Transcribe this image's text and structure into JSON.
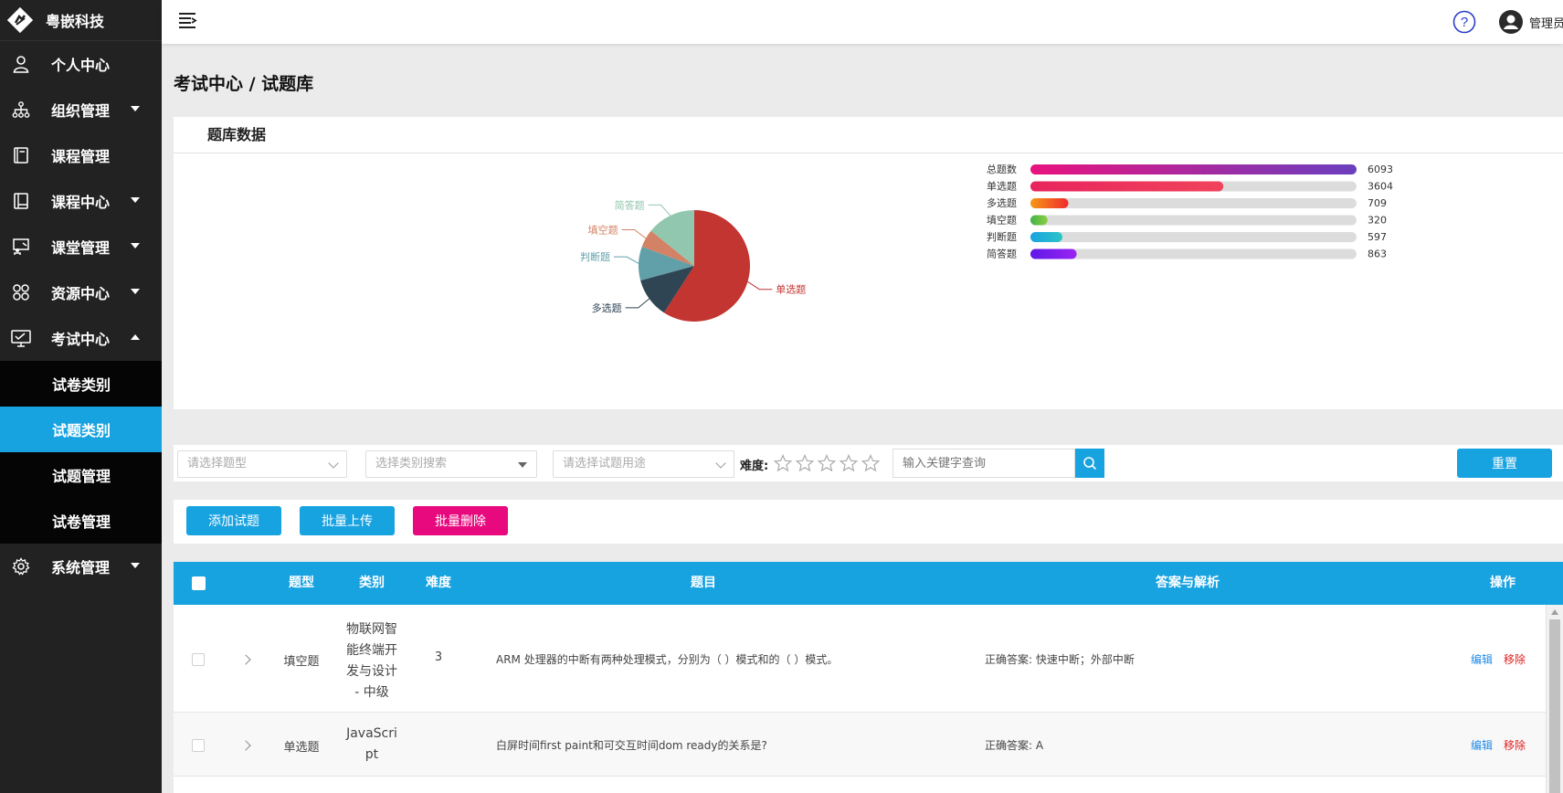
{
  "app": {
    "name": "粤嵌科技"
  },
  "sidebar": {
    "items": [
      {
        "label": "个人中心",
        "icon": "user-icon",
        "has_caret": false
      },
      {
        "label": "组织管理",
        "icon": "org-tree-icon",
        "has_caret": true
      },
      {
        "label": "课程管理",
        "icon": "book-icon",
        "has_caret": false
      },
      {
        "label": "课程中心",
        "icon": "book-open-icon",
        "has_caret": true
      },
      {
        "label": "课堂管理",
        "icon": "classroom-icon",
        "has_caret": true
      },
      {
        "label": "资源中心",
        "icon": "resource-grid-icon",
        "has_caret": true
      },
      {
        "label": "考试中心",
        "icon": "exam-monitor-icon",
        "has_caret": true,
        "expanded": true
      }
    ],
    "sub_items": [
      {
        "label": "试卷类别",
        "active": false
      },
      {
        "label": "试题类别",
        "active": true
      },
      {
        "label": "试题管理",
        "active": false
      },
      {
        "label": "试卷管理",
        "active": false
      }
    ],
    "system": {
      "label": "系统管理",
      "icon": "gear-icon"
    }
  },
  "header": {
    "username": "管理员"
  },
  "page": {
    "title": "考试中心 / 试题库"
  },
  "panel": {
    "title": "题库数据"
  },
  "chart_data": [
    {
      "type": "pie",
      "slices": [
        {
          "label": "单选题",
          "value": 3604,
          "color": "#c23531"
        },
        {
          "label": "多选题",
          "value": 709,
          "color": "#2f4554"
        },
        {
          "label": "判断题",
          "value": 597,
          "color": "#61a0a8"
        },
        {
          "label": "填空题",
          "value": 320,
          "color": "#d48265"
        },
        {
          "label": "简答题",
          "value": 863,
          "color": "#91c7ae"
        }
      ]
    },
    {
      "type": "bar",
      "orientation": "horizontal",
      "max": 6093,
      "bars": [
        {
          "label": "总题数",
          "value": 6093,
          "colors": [
            "#e8137e",
            "#6a3fbf"
          ]
        },
        {
          "label": "单选题",
          "value": 3604,
          "colors": [
            "#e8255d",
            "#f0435c"
          ]
        },
        {
          "label": "多选题",
          "value": 709,
          "colors": [
            "#f79818",
            "#ee2b2b"
          ]
        },
        {
          "label": "填空题",
          "value": 320,
          "colors": [
            "#42b24e",
            "#8ccf3e"
          ]
        },
        {
          "label": "判断题",
          "value": 597,
          "colors": [
            "#18a3e0",
            "#2cc4c8"
          ]
        },
        {
          "label": "简答题",
          "value": 863,
          "colors": [
            "#5e18e8",
            "#9a24f2"
          ]
        }
      ]
    }
  ],
  "filters": {
    "type_placeholder": "请选择题型",
    "category_placeholder": "选择类别搜索",
    "usage_placeholder": "请选择试题用途",
    "difficulty_label": "难度:",
    "difficulty_stars": 5,
    "keyword_placeholder": "输入关键字查询",
    "reset_label": "重置"
  },
  "actions": {
    "add": "添加试题",
    "upload": "批量上传",
    "delete": "批量删除"
  },
  "colors": {
    "accent": "#17a2e0",
    "danger": "#e8097e",
    "sidebar": "#222222"
  },
  "table": {
    "headers": {
      "type": "题型",
      "category": "类别",
      "difficulty": "难度",
      "question": "题目",
      "answer": "答案与解析",
      "op": "操作"
    },
    "edit_label": "编辑",
    "remove_label": "移除",
    "rows": [
      {
        "type": "填空题",
        "category_lines": [
          "物联网智",
          "能终端开",
          "发与设计",
          "- 中级"
        ],
        "difficulty": "3",
        "question": "ARM 处理器的中断有两种处理模式，分别为（ ）模式和的（ ）模式。",
        "answer": "正确答案: 快速中断；外部中断"
      },
      {
        "type": "单选题",
        "category_lines": [
          "JavaScri",
          "pt"
        ],
        "difficulty": "",
        "question": "白屏时间first paint和可交互时间dom ready的关系是?",
        "answer": "正确答案: A"
      }
    ]
  }
}
